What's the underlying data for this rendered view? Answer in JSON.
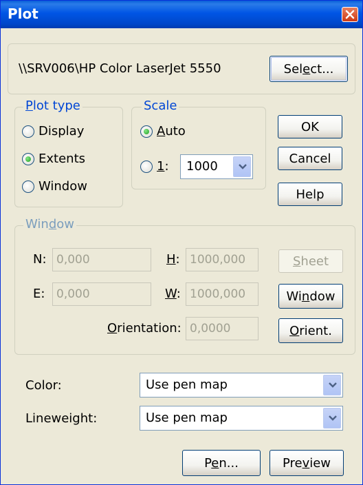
{
  "window": {
    "title": "Plot"
  },
  "printer": {
    "name": "\\\\SRV006\\HP Color LaserJet 5550",
    "select_label": "Select..."
  },
  "plot_type": {
    "legend": "Plot type",
    "options": [
      "Display",
      "Extents",
      "Window"
    ],
    "selected": "Extents"
  },
  "scale": {
    "legend": "Scale",
    "auto_label": "Auto",
    "ratio_label": "1:",
    "ratio_value": "1000",
    "selected": "Auto"
  },
  "buttons": {
    "ok": "OK",
    "cancel": "Cancel",
    "help": "Help"
  },
  "window_group": {
    "legend": "Window",
    "n_label": "N:",
    "n_value": "0,000",
    "e_label": "E:",
    "e_value": "0,000",
    "h_label": "H:",
    "h_value": "1000,000",
    "w_label": "W:",
    "w_value": "1000,000",
    "orientation_label": "Orientation:",
    "orientation_value": "0,0000",
    "sheet_label": "Sheet",
    "window_label": "Window",
    "orient_label": "Orient."
  },
  "color": {
    "label": "Color:",
    "value": "Use pen map"
  },
  "lineweight": {
    "label": "Lineweight:",
    "value": "Use pen map"
  },
  "footer": {
    "pen_label": "Pen...",
    "preview_label": "Preview"
  }
}
